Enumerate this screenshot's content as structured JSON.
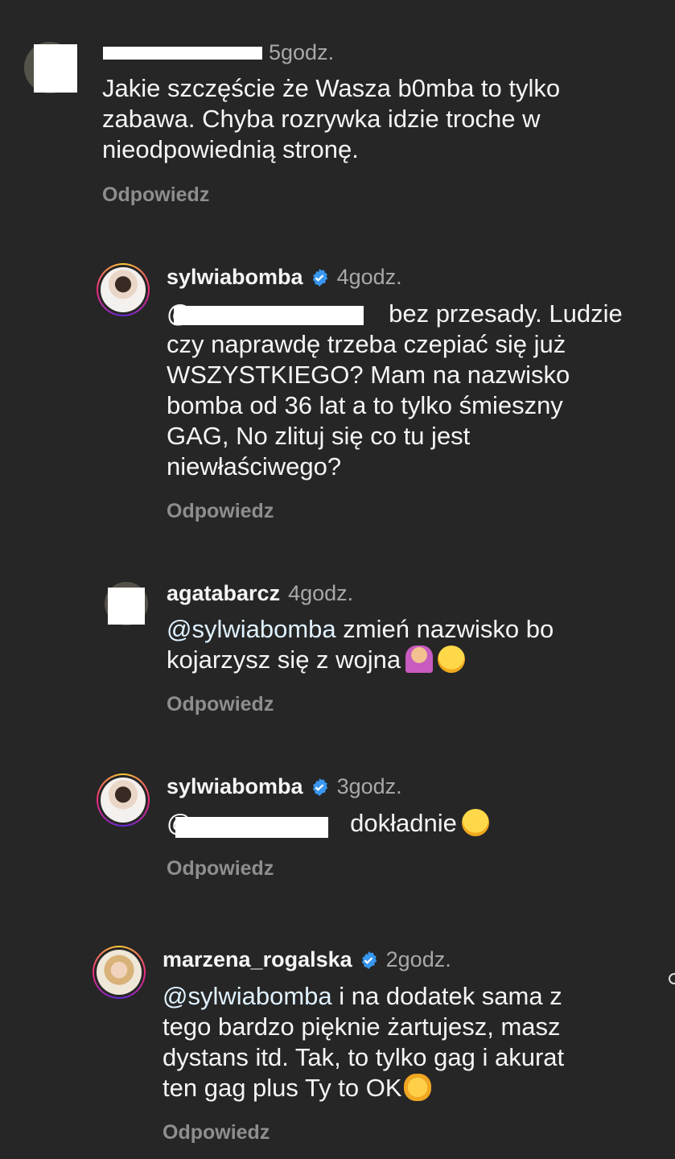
{
  "comments": [
    {
      "username_visible": "",
      "time": "5godz.",
      "text": "Jakie szczęście że Wasza b0mba to tylko\nzabawa. Chyba rozrywka idzie troche w\nnieodpowiednią stronę.",
      "reply_label": "Odpowiedz"
    },
    {
      "username": "sylwiabomba",
      "verified": true,
      "time": "4godz.",
      "mention_prefix": "@",
      "text_after_mention": " bez przesady. Ludzie",
      "text_rest": "czy naprawdę trzeba czepiać się już\nWSZYSTKIEGO? Mam na nazwisko\nbomba od 36 lat a to tylko śmieszny\nGAG, No zlituj się co tu jest\nniewłaściwego?",
      "reply_label": "Odpowiedz"
    },
    {
      "username": "agatabarcz",
      "time": "4godz.",
      "mention": "@sylwiabomba",
      "text_line1": " zmień nazwisko bo",
      "text_line2": "kojarzysz się z wojna",
      "emojis": [
        "woman-tipping-hand-emoji",
        "face-with-tears-of-joy-emoji"
      ],
      "reply_label": "Odpowiedz"
    },
    {
      "username": "sylwiabomba",
      "verified": true,
      "time": "3godz.",
      "mention_prefix": "@",
      "text_after_mention": " dokładnie",
      "emojis": [
        "face-with-tears-of-joy-emoji"
      ],
      "reply_label": "Odpowiedz"
    },
    {
      "username": "marzena_rogalska",
      "verified": true,
      "time": "2godz.",
      "mention": "@sylwiabomba",
      "text_line1": " i na dodatek sama z",
      "text_rest": "tego bardzo pięknie żartujesz, masz\ndystans itd. Tak, to tylko gag i akurat\nten gag plus Ty to OK",
      "emojis": [
        "ok-hand-emoji"
      ],
      "reply_label": "Odpowiedz"
    }
  ],
  "colors": {
    "background": "#262626",
    "text": "#f5f5f5",
    "muted": "#a8a8a8",
    "reply": "#8e8e8e",
    "mention": "#e0f1ff",
    "verified": "#3897f0"
  }
}
